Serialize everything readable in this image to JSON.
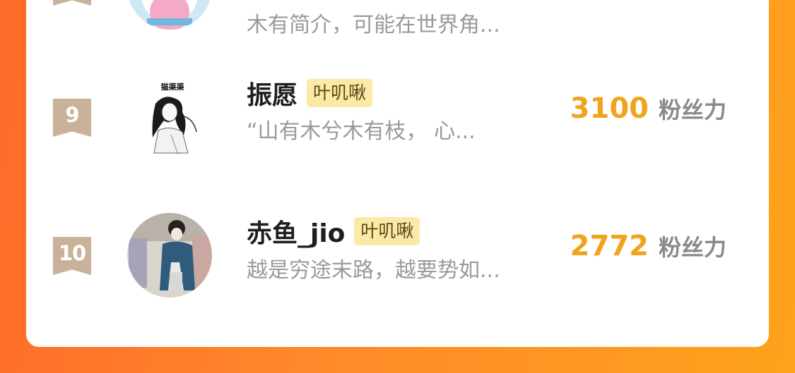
{
  "page": {
    "accent": "#f2a31c",
    "background": "#ff8a2a"
  },
  "leaderboard": {
    "partial_row": {
      "bio": "木有简介，可能在世界角..."
    },
    "rows": [
      {
        "rank": "9",
        "name": "振愿",
        "tag": "叶叽啾",
        "bio": "“山有木兮木有枝， 心...",
        "score": "3100",
        "score_unit": "粉丝力"
      },
      {
        "rank": "10",
        "name": "赤鱼_jio",
        "tag": "叶叽啾",
        "bio": "越是穷途末路，越要势如...",
        "score": "2772",
        "score_unit": "粉丝力"
      }
    ]
  },
  "avatar_labels": {
    "row9_header": "猫渠渠"
  }
}
